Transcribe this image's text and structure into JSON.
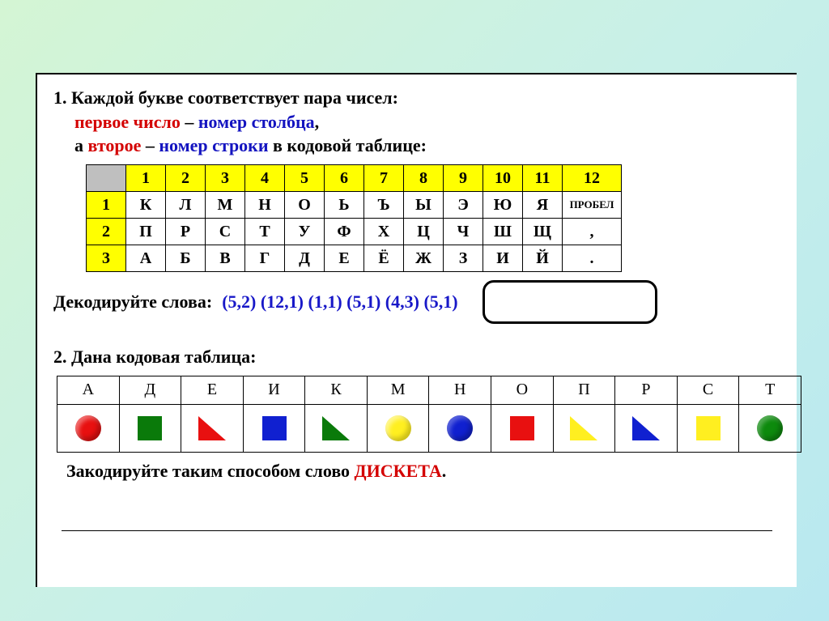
{
  "task1": {
    "num": "1.",
    "t1": "Каждой букве соответствует пара чисел:",
    "t2a": "первое число",
    "t2b": " – ",
    "t2c": "номер столбца",
    "t2d": ",",
    "t3a": "а ",
    "t3b": "второе",
    "t3c": " – ",
    "t3d": "номер строки",
    "t3e": " в кодовой таблице:"
  },
  "table1": {
    "cols": [
      "1",
      "2",
      "3",
      "4",
      "5",
      "6",
      "7",
      "8",
      "9",
      "10",
      "11",
      "12"
    ],
    "rows": [
      {
        "h": "1",
        "cells": [
          "К",
          "Л",
          "М",
          "Н",
          "О",
          "Ь",
          "Ъ",
          "Ы",
          "Э",
          "Ю",
          "Я",
          "ПРОБЕЛ"
        ]
      },
      {
        "h": "2",
        "cells": [
          "П",
          "Р",
          "С",
          "Т",
          "У",
          "Ф",
          "Х",
          "Ц",
          "Ч",
          "Ш",
          "Щ",
          ","
        ]
      },
      {
        "h": "3",
        "cells": [
          "А",
          "Б",
          "В",
          "Г",
          "Д",
          "Е",
          "Ё",
          "Ж",
          "З",
          "И",
          "Й",
          "."
        ]
      }
    ]
  },
  "decode": {
    "label": "Декодируйте слова:",
    "codes": "(5,2)  (12,1)  (1,1)  (5,1)  (4,3)  (5,1)"
  },
  "task2": {
    "num": "2.",
    "title": "Дана кодовая таблица:"
  },
  "table2": {
    "letters": [
      "А",
      "Д",
      "Е",
      "И",
      "К",
      "М",
      "Н",
      "О",
      "П",
      "Р",
      "С",
      "Т"
    ],
    "shapes": [
      "circle-red",
      "square-green",
      "tri-red",
      "square-blue",
      "tri-green",
      "circle-yellow",
      "circle-blue",
      "square-red",
      "tri-yellow",
      "tri-blue",
      "square-yellow",
      "circle-dgreen"
    ]
  },
  "encode": {
    "t1": "Закодируйте таким способом слово ",
    "word": "ДИСКЕТА",
    "dot": "."
  }
}
